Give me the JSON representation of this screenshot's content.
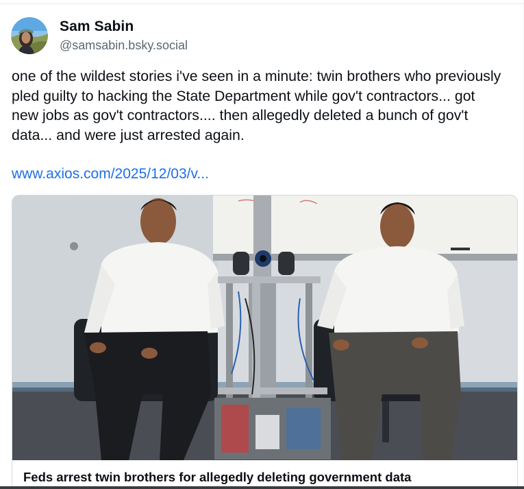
{
  "author": {
    "display_name": "Sam Sabin",
    "handle": "@samsabin.bsky.social",
    "avatar_icon": "user-avatar"
  },
  "post": {
    "text": "one of the wildest stories i've seen in a minute: twin brothers who previously pled guilty to hacking the State Department while gov't contractors... got new jobs as gov't contractors.... then allegedly deleted a bunch of gov't data... and were just arrested again.",
    "link_text": "www.axios.com/2025/12/03/v..."
  },
  "embed": {
    "title": "Feds arrest twin brothers for allegedly deleting government data"
  },
  "colors": {
    "link": "#1d6fe8",
    "text": "#0b0f14",
    "muted": "#5b6773",
    "border": "#d4d9de"
  }
}
